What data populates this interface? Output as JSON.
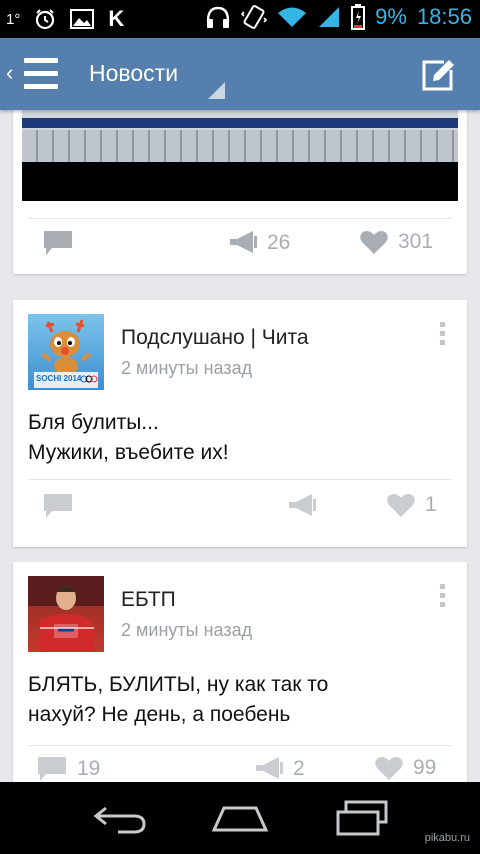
{
  "status_bar": {
    "notification_number": "1°",
    "icons_left": [
      "alarm-icon",
      "image-icon",
      "vk-icon"
    ],
    "vk_letter": "K",
    "icons_right": [
      "headset-icon",
      "vibrate-icon",
      "wifi-icon",
      "signal-icon",
      "battery-icon"
    ],
    "battery": "9%",
    "clock": "18:56",
    "accent_color": "#35b5e5"
  },
  "action_bar": {
    "title": "Новости",
    "back_symbol": "‹",
    "color": "#5580ae"
  },
  "posts": [
    {
      "partial": true,
      "media": "video-frame",
      "reposts": "26",
      "likes": "301"
    },
    {
      "author": "Подслушано | Чита",
      "time": "2 минуты назад",
      "text_lines": [
        "Бля булиты...",
        "Мужики, въебите их!"
      ],
      "likes": "1",
      "avatar_text": "SOCHI 2014"
    },
    {
      "author": "ЕБТП",
      "time": "2 минуты назад",
      "text_lines": [
        "БЛЯТЬ, БУЛИТЫ, ну как так то",
        "нахуй? Не день, а поебень"
      ],
      "comments": "19",
      "reposts": "2",
      "likes": "99"
    }
  ],
  "nav_bar": {
    "buttons": [
      "back-icon",
      "home-icon",
      "recent-apps-icon"
    ],
    "watermark": "pikabu.ru"
  }
}
